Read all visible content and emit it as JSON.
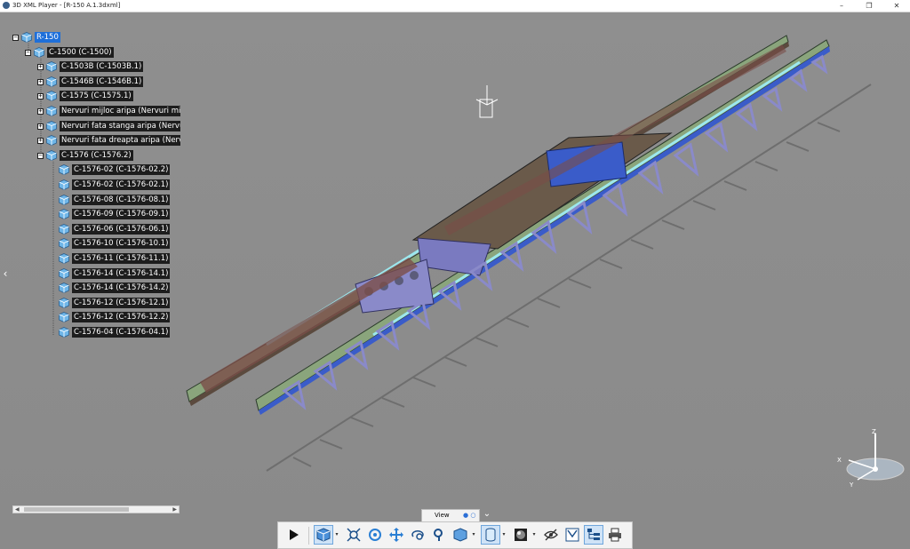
{
  "window": {
    "title": "3D XML Player - [R-150 A.1.3dxml]",
    "minimize": "–",
    "restore": "❐",
    "close": "✕"
  },
  "tree": {
    "items": [
      {
        "label": "R-150",
        "level": 0,
        "toggle": "−",
        "selected": true
      },
      {
        "label": "C-1500 (C-1500)",
        "level": 1,
        "toggle": "−"
      },
      {
        "label": "C-1503B (C-1503B.1)",
        "level": 2,
        "toggle": "+"
      },
      {
        "label": "C-1546B (C-1546B.1)",
        "level": 2,
        "toggle": "+"
      },
      {
        "label": "C-1575 (C-1575.1)",
        "level": 2,
        "toggle": "+"
      },
      {
        "label": "Nervuri mijloc aripa (Nervuri mijloc",
        "level": 2,
        "toggle": "+"
      },
      {
        "label": "Nervuri fata stanga aripa (Nervur",
        "level": 2,
        "toggle": "+"
      },
      {
        "label": "Nervuri fata dreapta aripa (Nervu",
        "level": 2,
        "toggle": "+"
      },
      {
        "label": "C-1576 (C-1576.2)",
        "level": 2,
        "toggle": "−"
      },
      {
        "label": "C-1576-02 (C-1576-02.2)",
        "level": 3
      },
      {
        "label": "C-1576-02 (C-1576-02.1)",
        "level": 3
      },
      {
        "label": "C-1576-08 (C-1576-08.1)",
        "level": 3
      },
      {
        "label": "C-1576-09 (C-1576-09.1)",
        "level": 3
      },
      {
        "label": "C-1576-06 (C-1576-06.1)",
        "level": 3
      },
      {
        "label": "C-1576-10 (C-1576-10.1)",
        "level": 3
      },
      {
        "label": "C-1576-11 (C-1576-11.1)",
        "level": 3
      },
      {
        "label": "C-1576-14 (C-1576-14.1)",
        "level": 3
      },
      {
        "label": "C-1576-14 (C-1576-14.2)",
        "level": 3
      },
      {
        "label": "C-1576-12 (C-1576-12.1)",
        "level": 3
      },
      {
        "label": "C-1576-12 (C-1576-12.2)",
        "level": 3
      },
      {
        "label": "C-1576-04 (C-1576-04.1)",
        "level": 3
      }
    ]
  },
  "compass": {
    "x": "X",
    "y": "Y",
    "z": "Z"
  },
  "view_panel": {
    "tab_label": "View",
    "dots": "● ○"
  },
  "toolbar": {
    "buttons": [
      {
        "name": "play-button",
        "icon": "play-icon"
      },
      {
        "name": "view-mode-button",
        "icon": "cube-view-icon"
      },
      {
        "name": "fit-all-button",
        "icon": "fit-all-icon"
      },
      {
        "name": "rotate-button",
        "icon": "rotate-icon"
      },
      {
        "name": "pan-button",
        "icon": "pan-icon"
      },
      {
        "name": "orbit-button",
        "icon": "orbit-icon"
      },
      {
        "name": "zoom-button",
        "icon": "zoom-icon"
      },
      {
        "name": "standard-views-button",
        "icon": "iso-view-icon"
      },
      {
        "name": "projection-button",
        "icon": "perspective-icon"
      },
      {
        "name": "render-style-button",
        "icon": "shading-icon"
      },
      {
        "name": "hide-show-button",
        "icon": "eye-icon"
      },
      {
        "name": "annotations-button",
        "icon": "annotation-icon"
      },
      {
        "name": "tree-toggle-button",
        "icon": "tree-icon"
      },
      {
        "name": "print-button",
        "icon": "printer-icon"
      }
    ]
  },
  "colors": {
    "background": "#8d8d8d",
    "selection": "#1e6fd9",
    "part_green": "#8aa57c",
    "part_cyan": "#9ce8ee",
    "part_blue": "#3a5cc9",
    "part_lavender": "#8a8ac9",
    "part_brown": "#7a4d48"
  }
}
